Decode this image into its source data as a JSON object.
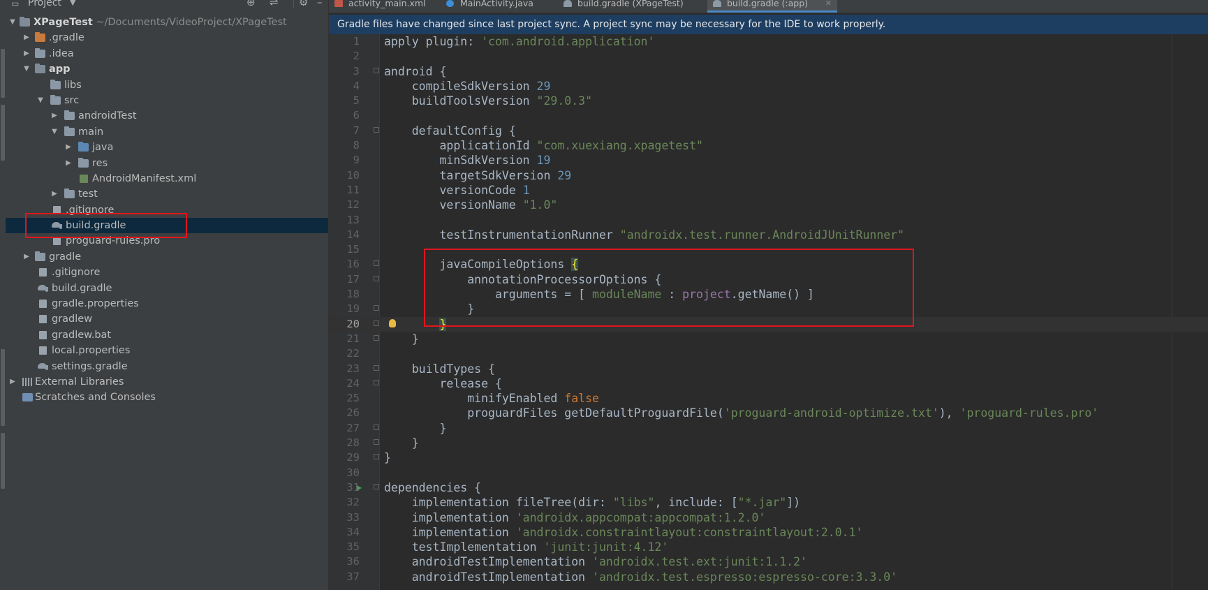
{
  "project_panel": {
    "title": "Project",
    "header_icons": [
      "target-icon",
      "collapse-icon",
      "gear-icon",
      "hide-icon"
    ],
    "tree": [
      {
        "name": "XPageTest",
        "path": "~/Documents/VideoProject/XPageTest",
        "icon": "module-folder",
        "expanded": true,
        "depth": 0,
        "bold": true
      },
      {
        "name": ".gradle",
        "icon": "folder-orange",
        "expanded": false,
        "depth": 1
      },
      {
        "name": ".idea",
        "icon": "folder",
        "expanded": false,
        "depth": 1
      },
      {
        "name": "app",
        "icon": "module-folder",
        "expanded": true,
        "depth": 1,
        "bold": true
      },
      {
        "name": "libs",
        "icon": "folder",
        "depth": 2
      },
      {
        "name": "src",
        "icon": "folder",
        "expanded": true,
        "depth": 2
      },
      {
        "name": "androidTest",
        "icon": "folder",
        "expanded": false,
        "depth": 3
      },
      {
        "name": "main",
        "icon": "folder",
        "expanded": true,
        "depth": 3
      },
      {
        "name": "java",
        "icon": "folder-blue",
        "expanded": false,
        "depth": 4
      },
      {
        "name": "res",
        "icon": "folder-res",
        "expanded": false,
        "depth": 4
      },
      {
        "name": "AndroidManifest.xml",
        "icon": "manifest-file",
        "depth": 5
      },
      {
        "name": "test",
        "icon": "folder",
        "expanded": false,
        "depth": 3
      },
      {
        "name": ".gitignore",
        "icon": "file",
        "depth": 3
      },
      {
        "name": "build.gradle",
        "icon": "gradle-file",
        "depth": 3,
        "selected": true
      },
      {
        "name": "proguard-rules.pro",
        "icon": "file",
        "depth": 3
      },
      {
        "name": "gradle",
        "icon": "folder",
        "expanded": false,
        "depth": 1
      },
      {
        "name": ".gitignore",
        "icon": "file",
        "depth": 2
      },
      {
        "name": "build.gradle",
        "icon": "gradle-file",
        "depth": 2
      },
      {
        "name": "gradle.properties",
        "icon": "file",
        "depth": 2
      },
      {
        "name": "gradlew",
        "icon": "file",
        "depth": 2
      },
      {
        "name": "gradlew.bat",
        "icon": "file",
        "depth": 2
      },
      {
        "name": "local.properties",
        "icon": "file",
        "depth": 2
      },
      {
        "name": "settings.gradle",
        "icon": "gradle-file",
        "depth": 2
      },
      {
        "name": "External Libraries",
        "icon": "libraries",
        "expanded": false,
        "depth": 0
      },
      {
        "name": "Scratches and Consoles",
        "icon": "scratches",
        "depth": 0
      }
    ]
  },
  "tabs": [
    {
      "label": "activity_main.xml",
      "icon": "xml-layout-icon",
      "active": false
    },
    {
      "label": "MainActivity.java",
      "icon": "java-class-icon",
      "active": false
    },
    {
      "label": "build.gradle (XPageTest)",
      "icon": "gradle-icon",
      "active": false
    },
    {
      "label": "build.gradle (:app)",
      "icon": "gradle-icon",
      "active": true
    }
  ],
  "notice": "Gradle files have changed since last project sync. A project sync may be necessary for the IDE to work properly.",
  "editor": {
    "current_line": 20,
    "lines": [
      {
        "n": "1",
        "code": "apply plugin: 'com.android.application'"
      },
      {
        "n": "2",
        "code": ""
      },
      {
        "n": "3",
        "code": "android {"
      },
      {
        "n": "4",
        "code": "    compileSdkVersion 29"
      },
      {
        "n": "5",
        "code": "    buildToolsVersion \"29.0.3\""
      },
      {
        "n": "6",
        "code": ""
      },
      {
        "n": "7",
        "code": "    defaultConfig {"
      },
      {
        "n": "8",
        "code": "        applicationId \"com.xuexiang.xpagetest\""
      },
      {
        "n": "9",
        "code": "        minSdkVersion 19"
      },
      {
        "n": "10",
        "code": "        targetSdkVersion 29"
      },
      {
        "n": "11",
        "code": "        versionCode 1"
      },
      {
        "n": "12",
        "code": "        versionName \"1.0\""
      },
      {
        "n": "13",
        "code": ""
      },
      {
        "n": "14",
        "code": "        testInstrumentationRunner \"androidx.test.runner.AndroidJUnitRunner\""
      },
      {
        "n": "15",
        "code": ""
      },
      {
        "n": "16",
        "code": "        javaCompileOptions {"
      },
      {
        "n": "17",
        "code": "            annotationProcessorOptions {"
      },
      {
        "n": "18",
        "code": "                arguments = [ moduleName : project.getName() ]"
      },
      {
        "n": "19",
        "code": "            }"
      },
      {
        "n": "20",
        "code": "        }"
      },
      {
        "n": "21",
        "code": "    }"
      },
      {
        "n": "22",
        "code": ""
      },
      {
        "n": "23",
        "code": "    buildTypes {"
      },
      {
        "n": "24",
        "code": "        release {"
      },
      {
        "n": "25",
        "code": "            minifyEnabled false"
      },
      {
        "n": "26",
        "code": "            proguardFiles getDefaultProguardFile('proguard-android-optimize.txt'), 'proguard-rules.pro'"
      },
      {
        "n": "27",
        "code": "        }"
      },
      {
        "n": "28",
        "code": "    }"
      },
      {
        "n": "29",
        "code": "}"
      },
      {
        "n": "30",
        "code": ""
      },
      {
        "n": "31",
        "code": "dependencies {"
      },
      {
        "n": "32",
        "code": "    implementation fileTree(dir: \"libs\", include: [\"*.jar\"])"
      },
      {
        "n": "33",
        "code": "    implementation 'androidx.appcompat:appcompat:1.2.0'"
      },
      {
        "n": "34",
        "code": "    implementation 'androidx.constraintlayout:constraintlayout:2.0.1'"
      },
      {
        "n": "35",
        "code": "    testImplementation 'junit:junit:4.12'"
      },
      {
        "n": "36",
        "code": "    androidTestImplementation 'androidx.test.ext:junit:1.1.2'"
      },
      {
        "n": "37",
        "code": "    androidTestImplementation 'androidx.test.espresso:espresso-core:3.3.0'"
      }
    ]
  },
  "colors": {
    "background": "#2b2b2b",
    "panel": "#3c3f41",
    "selection": "#0d293e",
    "notice": "#1e3e61",
    "highlight": "#e0161e",
    "string": "#6a8759",
    "number": "#6897bb",
    "keyword": "#cc7832",
    "property": "#9876aa"
  }
}
